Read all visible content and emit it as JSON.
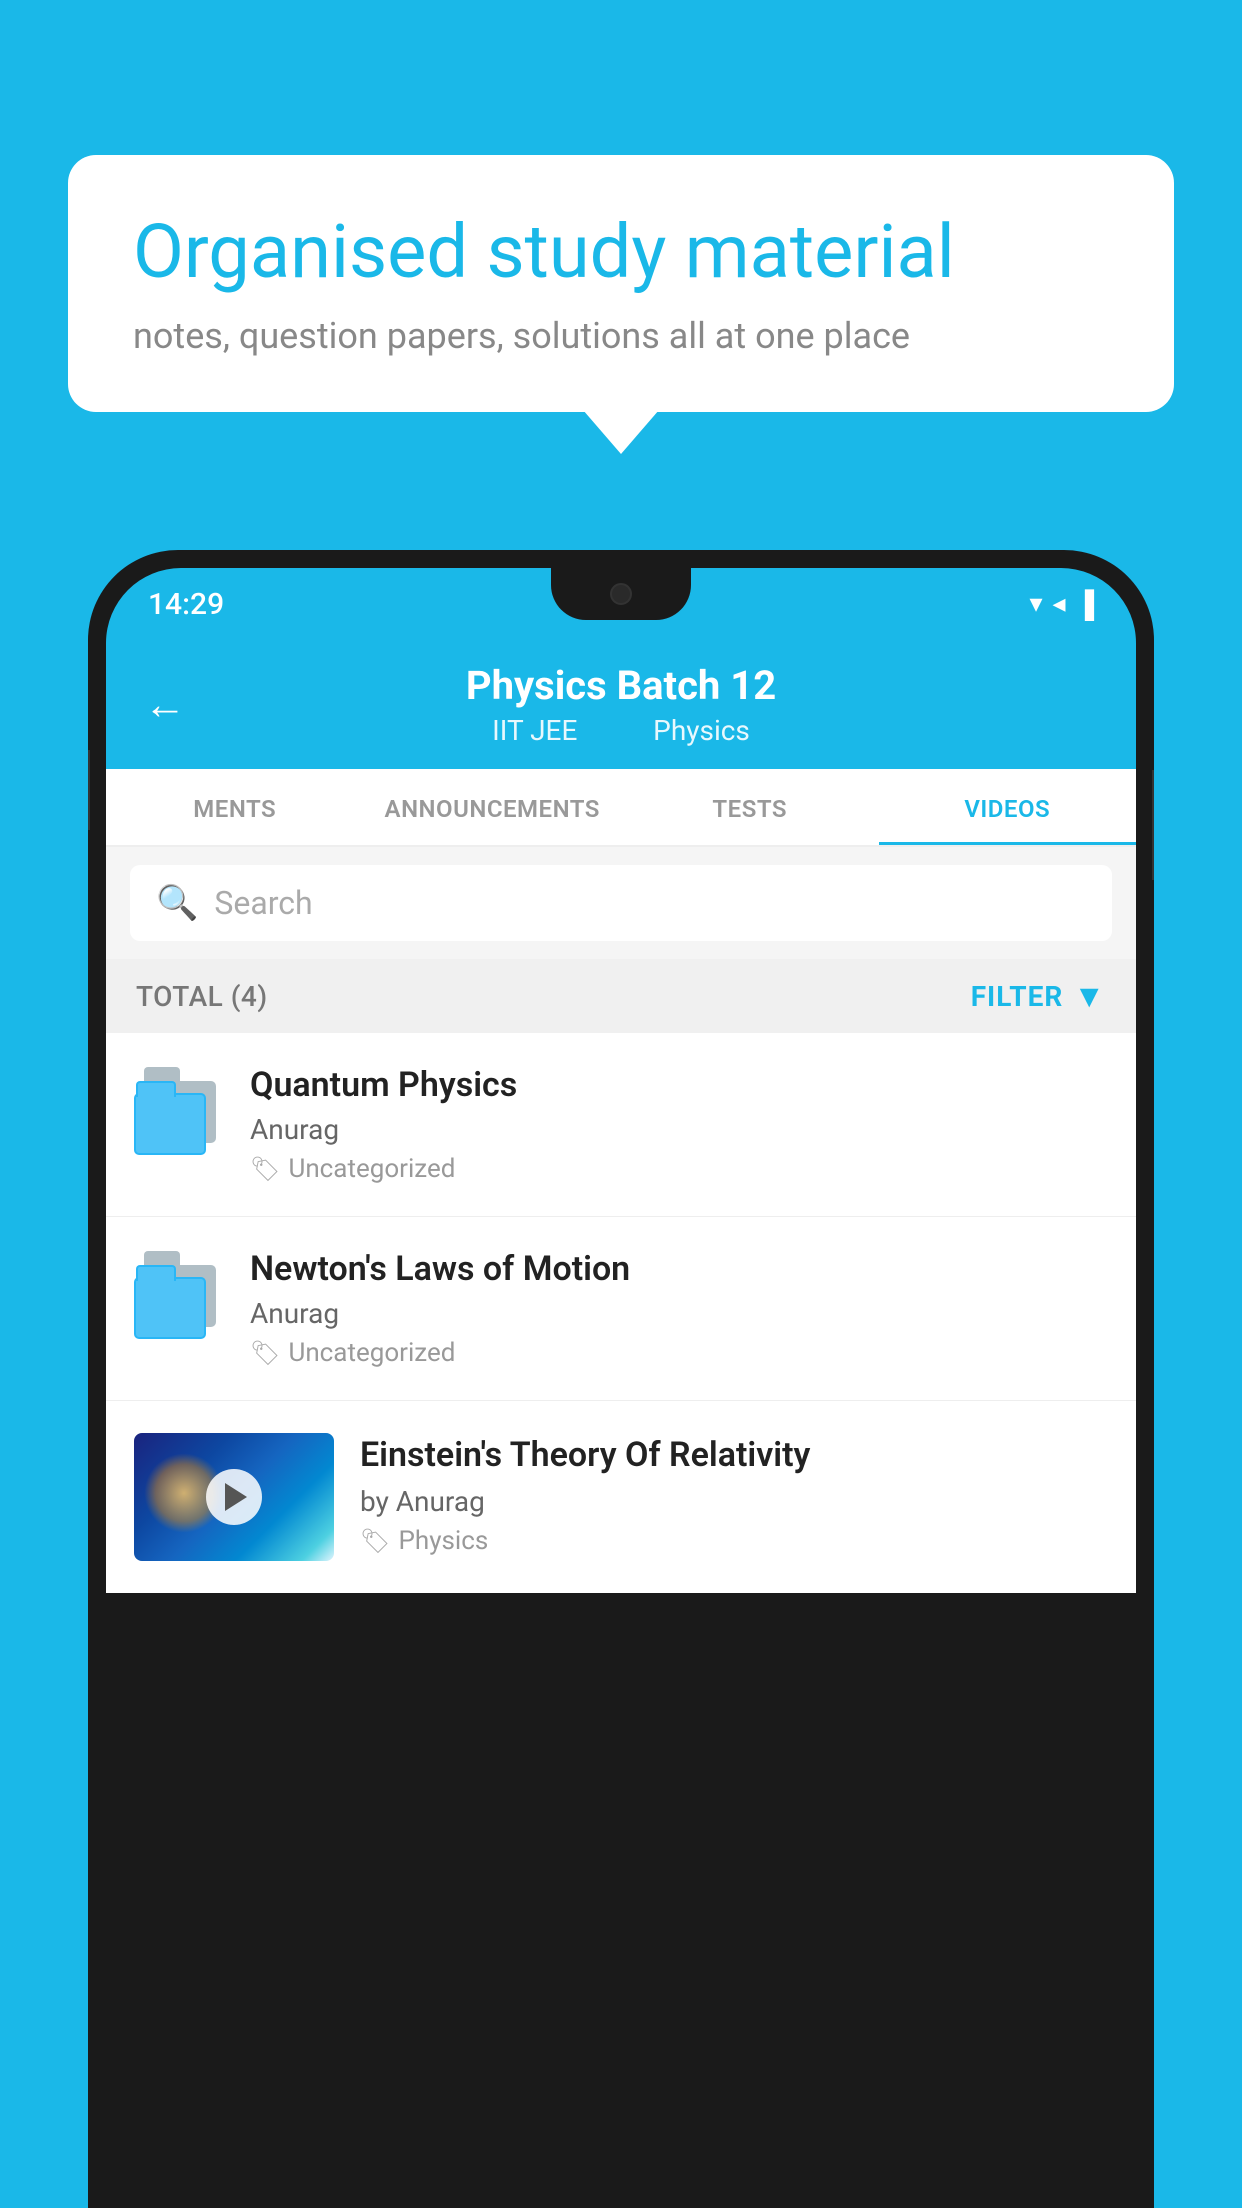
{
  "page": {
    "background_color": "#1ab8e8"
  },
  "speech_bubble": {
    "heading": "Organised study material",
    "subtext": "notes, question papers, solutions all at one place"
  },
  "status_bar": {
    "time": "14:29",
    "icons": [
      "wifi",
      "signal",
      "battery"
    ]
  },
  "app_header": {
    "title": "Physics Batch 12",
    "subtitle_part1": "IIT JEE",
    "subtitle_part2": "Physics",
    "back_arrow": "←"
  },
  "tabs": [
    {
      "label": "MENTS",
      "active": false
    },
    {
      "label": "ANNOUNCEMENTS",
      "active": false
    },
    {
      "label": "TESTS",
      "active": false
    },
    {
      "label": "VIDEOS",
      "active": true
    }
  ],
  "search": {
    "placeholder": "Search"
  },
  "filter_row": {
    "total_label": "TOTAL (4)",
    "filter_label": "FILTER"
  },
  "videos": [
    {
      "title": "Quantum Physics",
      "author": "Anurag",
      "tag": "Uncategorized",
      "has_thumbnail": false
    },
    {
      "title": "Newton's Laws of Motion",
      "author": "Anurag",
      "tag": "Uncategorized",
      "has_thumbnail": false
    },
    {
      "title": "Einstein's Theory Of Relativity",
      "author": "by Anurag",
      "tag": "Physics",
      "has_thumbnail": true
    }
  ]
}
